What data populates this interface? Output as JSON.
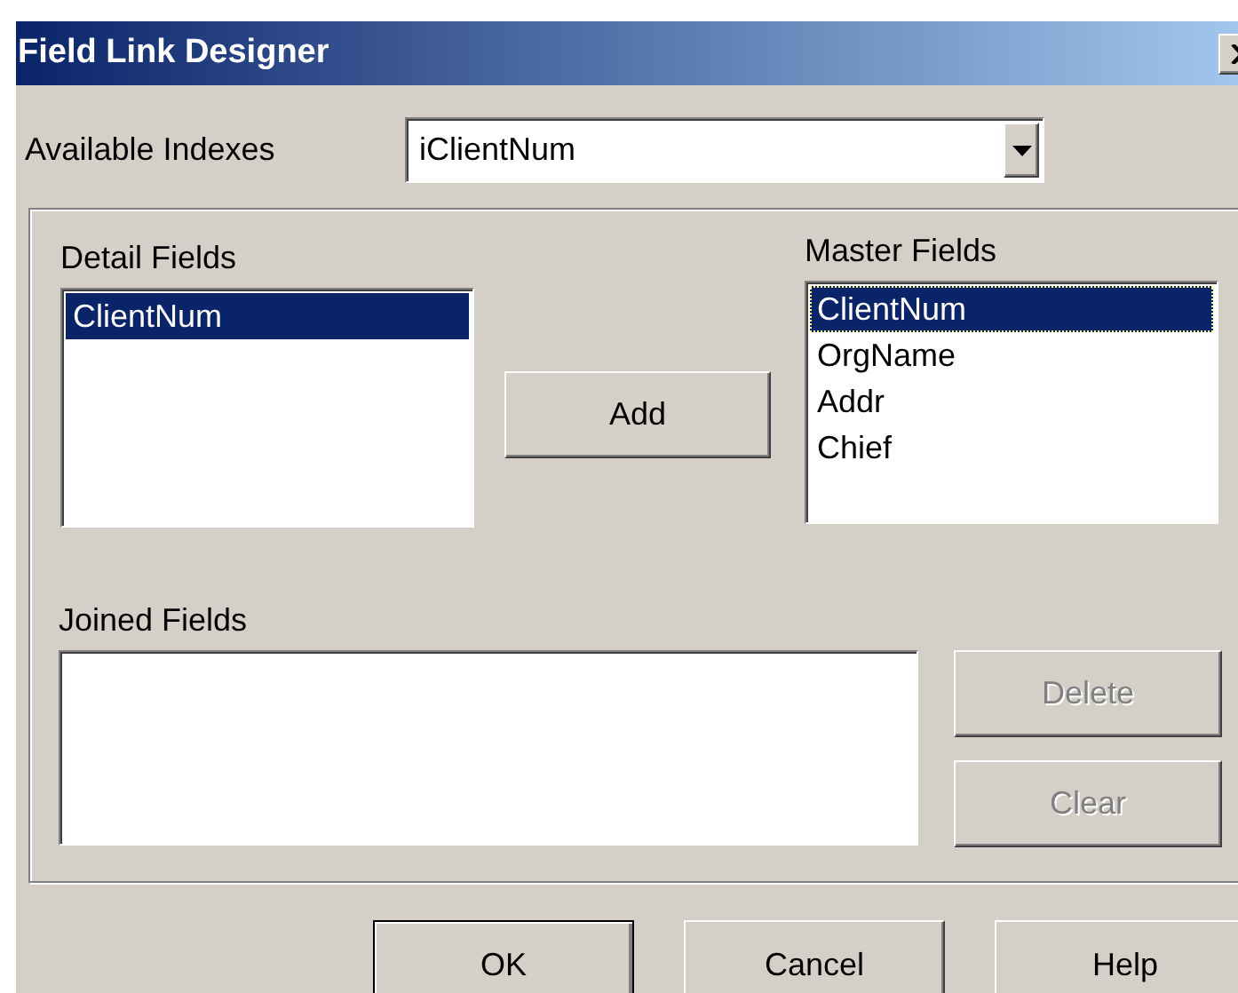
{
  "window": {
    "title": "Field Link Designer"
  },
  "available_indexes": {
    "label": "Available Indexes",
    "value": "iClientNum"
  },
  "detail_fields": {
    "label": "Detail Fields",
    "items": [
      {
        "text": "ClientNum",
        "selected": true,
        "focused": false
      }
    ]
  },
  "add_button": {
    "label": "Add",
    "disabled": false
  },
  "master_fields": {
    "label": "Master Fields",
    "items": [
      {
        "text": "ClientNum",
        "selected": true,
        "focused": true
      },
      {
        "text": "OrgName",
        "selected": false,
        "focused": false
      },
      {
        "text": "Addr",
        "selected": false,
        "focused": false
      },
      {
        "text": "Chief",
        "selected": false,
        "focused": false
      }
    ]
  },
  "joined_fields": {
    "label": "Joined Fields"
  },
  "side_buttons": [
    {
      "label": "Delete",
      "disabled": true
    },
    {
      "label": "Clear",
      "disabled": true
    }
  ],
  "buttons": [
    {
      "label": "OK",
      "default": true,
      "disabled": false
    },
    {
      "label": "Cancel",
      "default": false,
      "disabled": false
    },
    {
      "label": "Help",
      "default": false,
      "disabled": false
    }
  ]
}
